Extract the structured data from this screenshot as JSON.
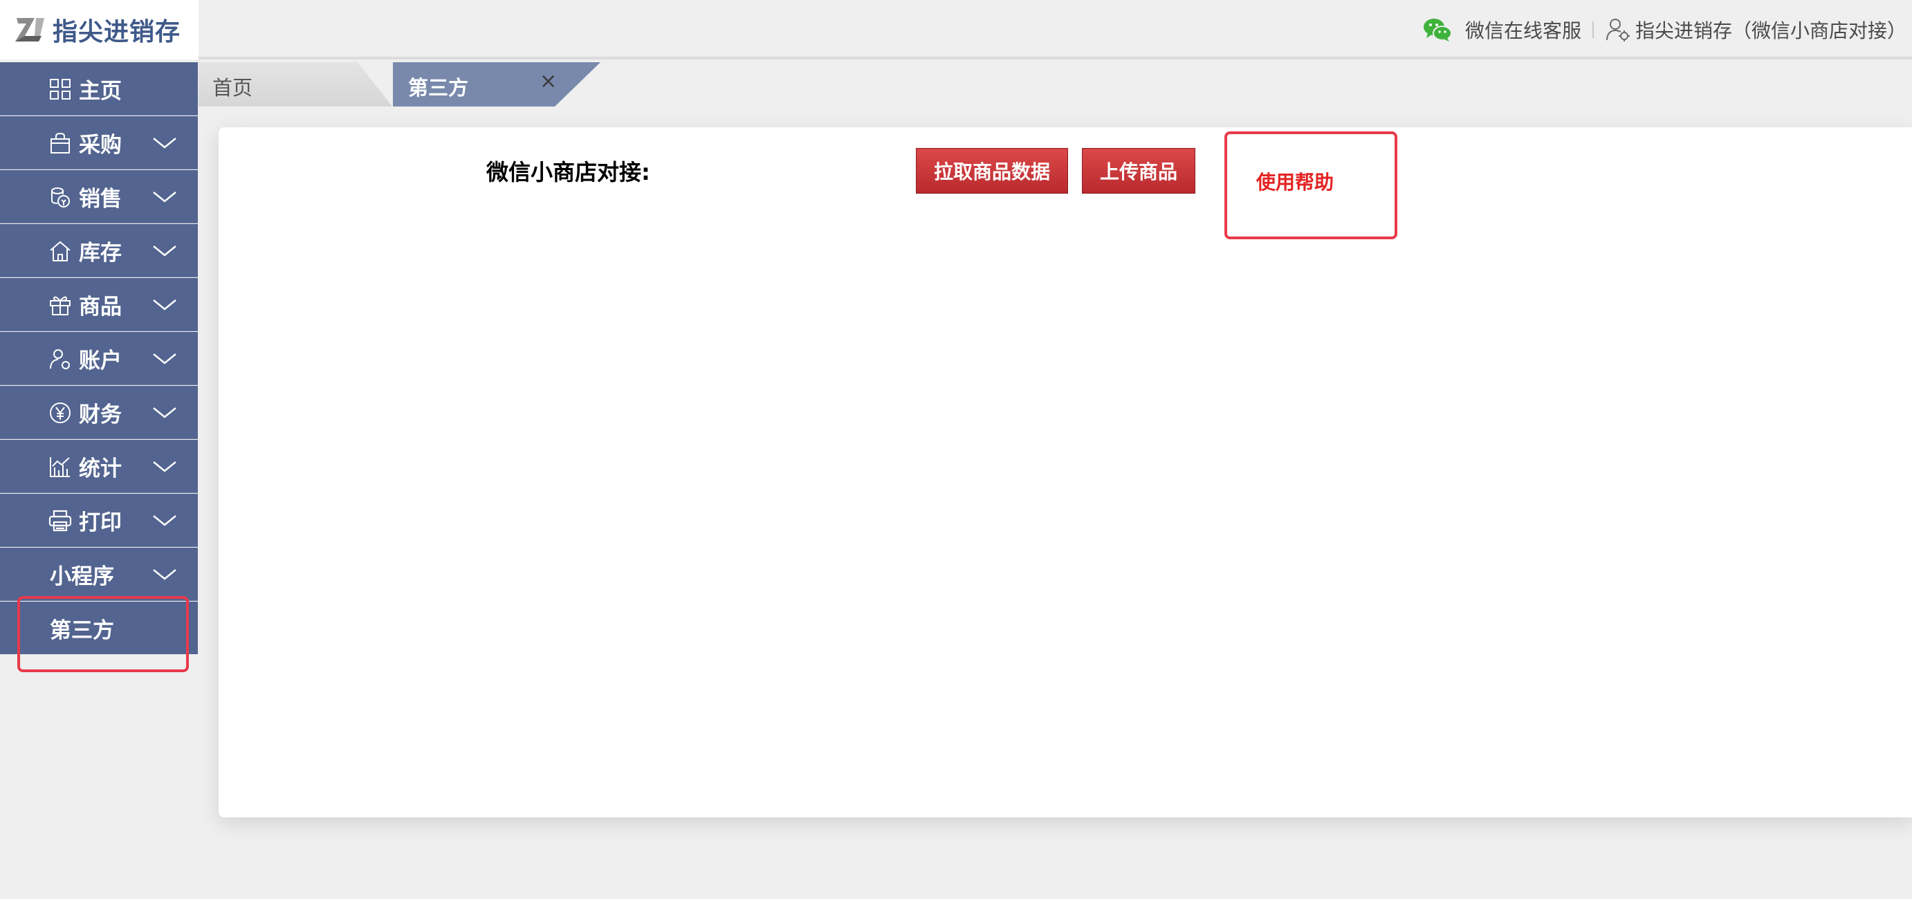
{
  "header": {
    "logo_text": "指尖进销存",
    "service_label": "微信在线客服",
    "user_label": "指尖进销存（微信小商店对接）"
  },
  "sidebar": {
    "items": [
      {
        "label": "主页",
        "icon": "grid-icon"
      },
      {
        "label": "采购",
        "icon": "bag-icon"
      },
      {
        "label": "销售",
        "icon": "coins-icon"
      },
      {
        "label": "库存",
        "icon": "home-icon"
      },
      {
        "label": "商品",
        "icon": "gift-icon"
      },
      {
        "label": "账户",
        "icon": "user-icon"
      },
      {
        "label": "财务",
        "icon": "yen-icon"
      },
      {
        "label": "统计",
        "icon": "chart-icon"
      },
      {
        "label": "打印",
        "icon": "printer-icon"
      },
      {
        "label": "小程序",
        "icon": ""
      }
    ],
    "sub_item": "第三方"
  },
  "tabs": {
    "home": "首页",
    "active": "第三方",
    "close_glyph": "×"
  },
  "main": {
    "section_title": "微信小商店对接:",
    "pull_button": "拉取商品数据",
    "upload_button": "上传商品",
    "help_link": "使用帮助"
  },
  "colors": {
    "sidebar_bg": "#52648f",
    "active_tab_bg": "#7889ab",
    "button_red": "#c7343a",
    "highlight": "#e83a4b",
    "help_text": "#e32222"
  }
}
